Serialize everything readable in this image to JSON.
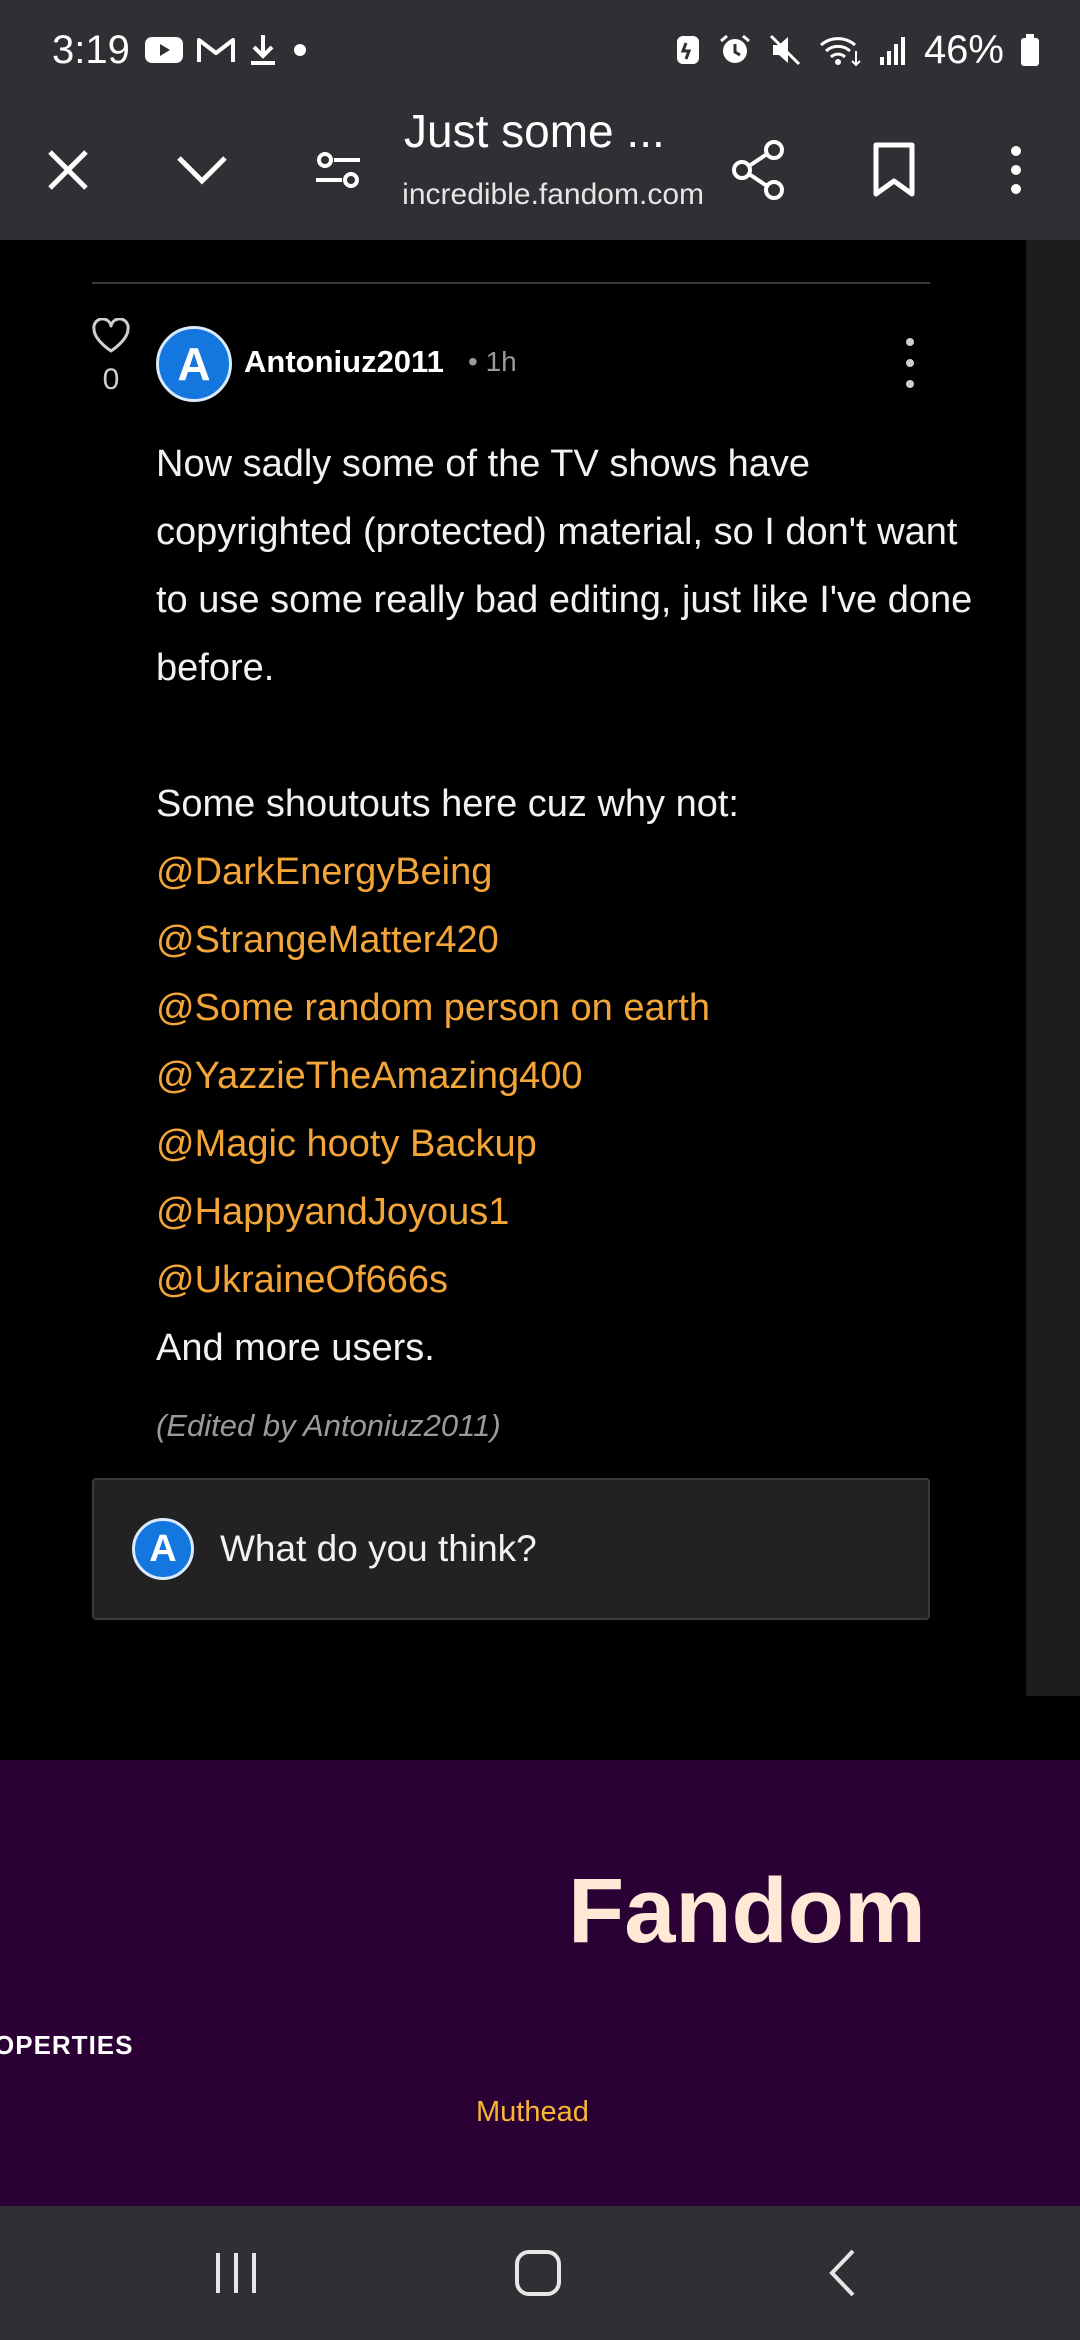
{
  "status_bar": {
    "time": "3:19",
    "battery": "46%"
  },
  "browser": {
    "title": "Just some ...",
    "url": "incredible.fandom.com"
  },
  "post": {
    "like_count": "0",
    "author": "Antoniuz2011",
    "time_ago": "• 1h",
    "avatar_letter": "A",
    "paragraph1": "Now sadly some of the TV shows have copyrighted (protected) material, so I don't want to use some really bad editing, just like I've done before.",
    "shoutout_intro": "Some shoutouts here cuz why not:",
    "mentions": [
      "@DarkEnergyBeing",
      "@StrangeMatter420",
      "@Some random person on earth",
      "@YazzieTheAmazing400",
      "@Magic hooty Backup",
      "@HappyandJoyous1",
      "@UkraineOf666s"
    ],
    "closing": "And more users.",
    "edited_note": "(Edited by Antoniuz2011)"
  },
  "reply": {
    "avatar_letter": "A",
    "placeholder": "What do you think?"
  },
  "footer": {
    "logo_text": "Fandom",
    "section_heading": "OPERTIES",
    "link": "Muthead"
  },
  "colors": {
    "mention": "#f3a538",
    "footer_bg": "#2a0035",
    "avatar": "#1477e0",
    "logo_flame": "#fa005a",
    "logo_heart": "#ffc500"
  }
}
